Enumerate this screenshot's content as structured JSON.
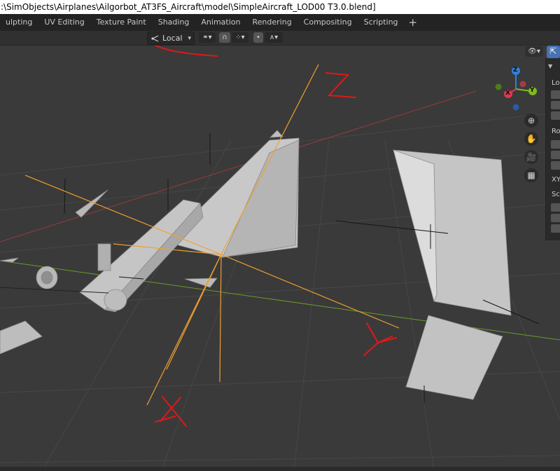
{
  "window": {
    "title": ":\\SimObjects\\Airplanes\\Ailgorbot_AT3FS_Aircraft\\model\\SimpleAircraft_LOD00 T3.0.blend]"
  },
  "workspace_tabs": [
    {
      "label": "ulpting"
    },
    {
      "label": "UV Editing"
    },
    {
      "label": "Texture Paint"
    },
    {
      "label": "Shading"
    },
    {
      "label": "Animation"
    },
    {
      "label": "Rendering"
    },
    {
      "label": "Compositing"
    },
    {
      "label": "Scripting"
    },
    {
      "label": "+"
    }
  ],
  "header": {
    "orientation": {
      "icon": "transform-orientation-icon",
      "value": "Local"
    }
  },
  "navigation_gizmo": {
    "axes": [
      {
        "label": "Z",
        "color": "#2f7fdb"
      },
      {
        "label": "Y",
        "color": "#7fba1f"
      },
      {
        "label": "X",
        "color": "#e0374f"
      }
    ]
  },
  "viewport_tools": [
    {
      "name": "zoom-icon",
      "glyph": "⊕"
    },
    {
      "name": "hand-icon",
      "glyph": "✋"
    },
    {
      "name": "camera-icon",
      "glyph": "🎥"
    },
    {
      "name": "grid-icon",
      "glyph": "▦"
    }
  ],
  "sidebar": {
    "labels": [
      {
        "text": "Lo"
      },
      {
        "text": "Ro"
      },
      {
        "text": "XY"
      },
      {
        "text": "Sc"
      }
    ]
  },
  "annotations": [
    {
      "label": "Z",
      "color": "#e01818"
    },
    {
      "label": "Y",
      "color": "#e01818"
    },
    {
      "label": "X",
      "color": "#e01818"
    }
  ],
  "colors": {
    "viewport_bg": "#3a3a3a",
    "grid_line": "#444444",
    "x_axis_line": "#9a3a3a",
    "y_axis_line": "#6a9a2a",
    "orientation_gizmo": "#f0a030",
    "annotation_red": "#e01818",
    "model_gray": "#c8c8c8"
  }
}
